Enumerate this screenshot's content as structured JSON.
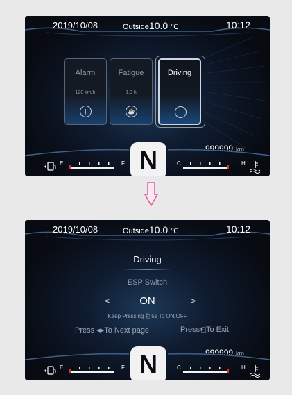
{
  "top_screen": {
    "date": "2019/10/08",
    "outside_label": "Outside",
    "outside_temp": "10.0",
    "temp_unit": "℃",
    "time": "10:12",
    "cards": [
      {
        "title": "Alarm",
        "value": "120 km/h",
        "icon": "info-icon",
        "active": false
      },
      {
        "title": "Fatigue",
        "value": "1.0 h",
        "icon": "coffee-icon",
        "active": false
      },
      {
        "title": "Driving",
        "value": "",
        "icon": "more-icon",
        "active": true
      }
    ],
    "odometer": "999999",
    "odometer_unit": "km",
    "gear": "N",
    "fuel_empty": "E",
    "fuel_full": "F",
    "temp_cold": "C",
    "temp_hot": "H",
    "fuel_icon": "fuel-pump-icon",
    "coolant_icon": "coolant-temp-icon"
  },
  "arrow": {
    "icon": "down-arrow-icon",
    "color": "#e05aa0"
  },
  "bottom_screen": {
    "date": "2019/10/08",
    "outside_label": "Outside",
    "outside_temp": "10.0",
    "temp_unit": "℃",
    "time": "10:12",
    "menu_title": "Driving",
    "setting_name": "ESP Switch",
    "setting_value": "ON",
    "left_arrow": "<",
    "right_arrow": ">",
    "hint_pre": "Keep Pressing",
    "hint_post": "5s To ON/OFF",
    "next_pre": "Press",
    "next_post": "To Next page",
    "exit_pre": "Press",
    "exit_post": "To Exit",
    "odometer": "999999",
    "odometer_unit": "km",
    "gear": "N",
    "fuel_empty": "E",
    "fuel_full": "F",
    "temp_cold": "C",
    "temp_hot": "H"
  },
  "colors": {
    "accent_blue": "#2a74c8",
    "red_mark": "#d9302c",
    "bg": "#0a0d14",
    "arrow_pink": "#e05aa0"
  }
}
